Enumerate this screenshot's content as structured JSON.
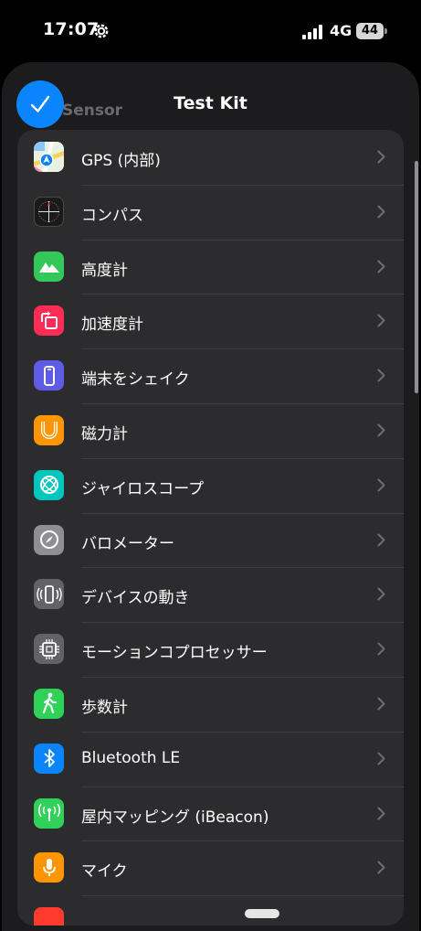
{
  "status_bar": {
    "time": "17:07",
    "network": "4G",
    "battery": "44"
  },
  "sheet": {
    "title": "Test Kit",
    "behind_title": "Sensor"
  },
  "sensors": [
    {
      "label": "GPS (内部)",
      "icon": "maps-icon",
      "color": "#ffffff"
    },
    {
      "label": "コンパス",
      "icon": "compass-icon",
      "color": "#1a1a1a"
    },
    {
      "label": "高度計",
      "icon": "mountain-icon",
      "color": "#34c759"
    },
    {
      "label": "加速度計",
      "icon": "rotate-icon",
      "color": "#ff2d55"
    },
    {
      "label": "端末をシェイク",
      "icon": "phone-icon",
      "color": "#5e5ce6"
    },
    {
      "label": "磁力計",
      "icon": "magnet-icon",
      "color": "#ff9500"
    },
    {
      "label": "ジャイロスコープ",
      "icon": "gyroscope-icon",
      "color": "#00c7be"
    },
    {
      "label": "バロメーター",
      "icon": "gauge-icon",
      "color": "#8e8e93"
    },
    {
      "label": "デバイスの動き",
      "icon": "device-motion-icon",
      "color": "#636366"
    },
    {
      "label": "モーションコプロセッサー",
      "icon": "chip-icon",
      "color": "#636366"
    },
    {
      "label": "歩数計",
      "icon": "walking-icon",
      "color": "#30d158"
    },
    {
      "label": "Bluetooth LE",
      "icon": "bluetooth-icon",
      "color": "#0a84ff"
    },
    {
      "label": "屋内マッピング (iBeacon)",
      "icon": "antenna-icon",
      "color": "#30d158"
    },
    {
      "label": "マイク",
      "icon": "microphone-icon",
      "color": "#ff9500"
    },
    {
      "label": "",
      "icon": "partial-icon",
      "color": "#ff3b30"
    }
  ]
}
